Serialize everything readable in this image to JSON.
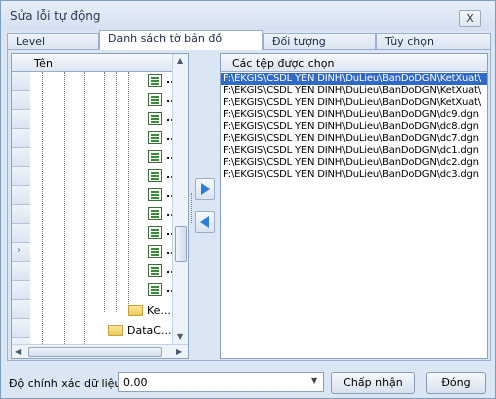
{
  "window": {
    "title": "Sửa lỗi tự động",
    "close_label": "X"
  },
  "tabs": [
    {
      "label": "Level"
    },
    {
      "label": "Danh sách tờ bản đồ",
      "active": true
    },
    {
      "label": "Đối tượng"
    },
    {
      "label": "Tùy chọn"
    }
  ],
  "tree": {
    "header": "Tên",
    "file_nodes": [
      "...",
      "...",
      "...",
      "...",
      "...",
      "...",
      "...",
      "...",
      "...",
      "...",
      "...",
      "..."
    ],
    "folders": [
      "Ke...",
      "DataC..."
    ]
  },
  "file_list": {
    "title": "Các tệp được chọn",
    "files": [
      "F:\\EKGIS\\CSDL YEN DINH\\DuLieu\\BanDoDGN\\KetXuat\\",
      "F:\\EKGIS\\CSDL YEN DINH\\DuLieu\\BanDoDGN\\KetXuat\\",
      "F:\\EKGIS\\CSDL YEN DINH\\DuLieu\\BanDoDGN\\KetXuat\\",
      "F:\\EKGIS\\CSDL YEN DINH\\DuLieu\\BanDoDGN\\dc9.dgn",
      "F:\\EKGIS\\CSDL YEN DINH\\DuLieu\\BanDoDGN\\dc8.dgn",
      "F:\\EKGIS\\CSDL YEN DINH\\DuLieu\\BanDoDGN\\dc7.dgn",
      "F:\\EKGIS\\CSDL YEN DINH\\DuLieu\\BanDoDGN\\dc1.dgn",
      "F:\\EKGIS\\CSDL YEN DINH\\DuLieu\\BanDoDGN\\dc2.dgn",
      "F:\\EKGIS\\CSDL YEN DINH\\DuLieu\\BanDoDGN\\dc3.dgn"
    ]
  },
  "footer": {
    "accuracy_label": "Độ chính xác dữ liệu:",
    "accuracy_value": "0.00",
    "accept_label": "Chấp nhận",
    "close_label": "Đóng"
  },
  "icons": {
    "move_right": "arrow-right-icon",
    "move_left": "arrow-left-icon",
    "file": "map-file-icon",
    "folder": "folder-icon"
  },
  "colors": {
    "selection": "#3169c6",
    "accent_arrow": "#2e7ed8",
    "background": "#dbe6f4"
  }
}
